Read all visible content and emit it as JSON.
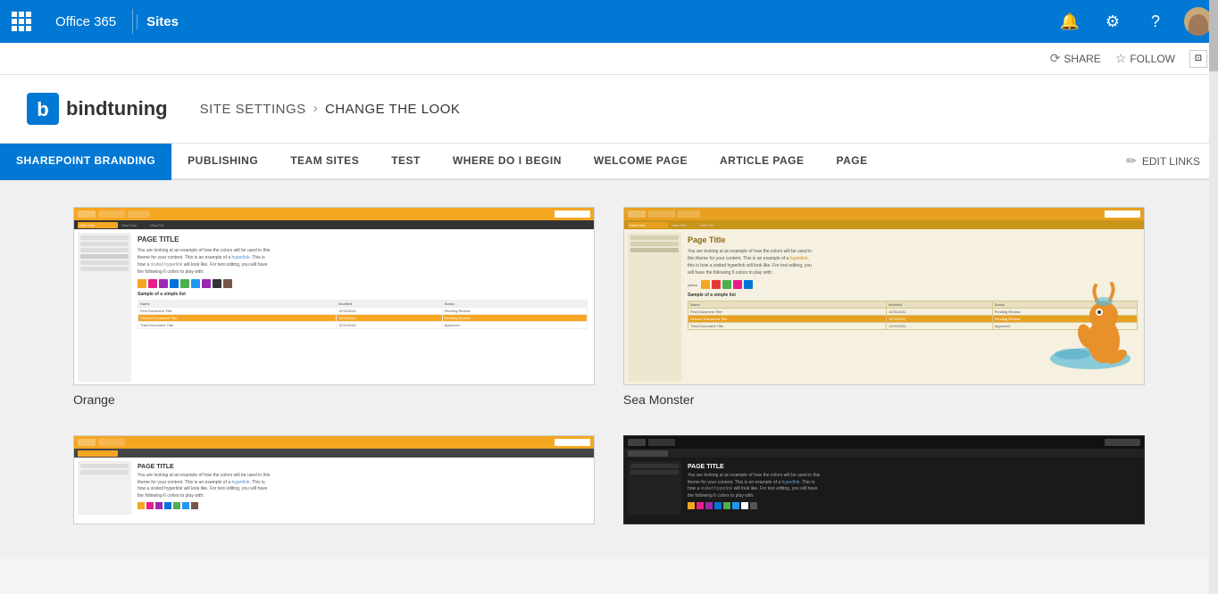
{
  "topbar": {
    "app_title": "Office 365",
    "section_title": "Sites",
    "icons": {
      "bell": "🔔",
      "gear": "⚙",
      "question": "?"
    }
  },
  "secondary_bar": {
    "share_label": "SHARE",
    "follow_label": "FOLLOW"
  },
  "site_header": {
    "brand_name": "bindtuning",
    "breadcrumb_parent": "SITE SETTINGS",
    "breadcrumb_sep": "›",
    "breadcrumb_current": "CHANGE THE LOOK"
  },
  "nav": {
    "tabs": [
      {
        "label": "SHAREPOINT BRANDING",
        "active": true
      },
      {
        "label": "PUBLISHING",
        "active": false
      },
      {
        "label": "TEAM SITES",
        "active": false
      },
      {
        "label": "TEST",
        "active": false
      },
      {
        "label": "WHERE DO I BEGIN",
        "active": false
      },
      {
        "label": "WELCOME PAGE",
        "active": false
      },
      {
        "label": "ARTICLE PAGE",
        "active": false
      },
      {
        "label": "PAGE",
        "active": false
      }
    ],
    "edit_links_label": "EDIT LINKS"
  },
  "themes": [
    {
      "id": "orange",
      "label": "Orange",
      "type": "orange"
    },
    {
      "id": "sea-monster",
      "label": "Sea Monster",
      "type": "sea"
    },
    {
      "id": "theme3",
      "label": "",
      "type": "orange2"
    },
    {
      "id": "theme4",
      "label": "",
      "type": "dark"
    }
  ],
  "colors": {
    "accent_blue": "#0078d4",
    "orange": "#f5a623",
    "sea_bg": "#f5f0e0"
  }
}
